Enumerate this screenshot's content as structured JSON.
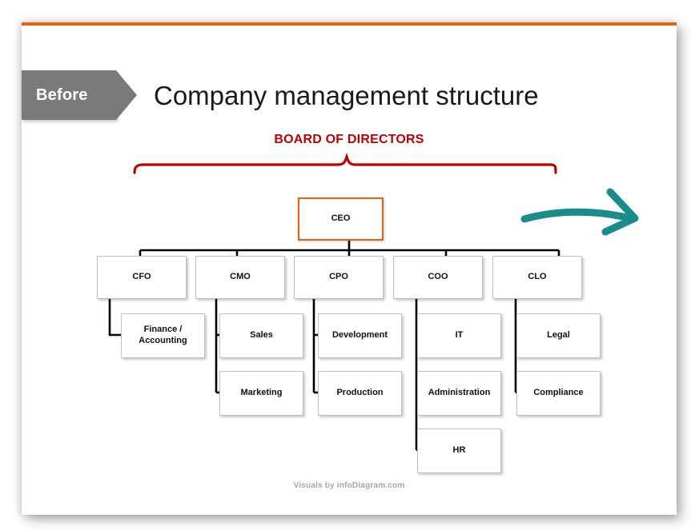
{
  "slide": {
    "before_badge": "Before",
    "title": "Company management structure",
    "footer": "Visuals by infoDiagram.com",
    "accent_top_bar_color": "#E8620C",
    "badge_color": "#7A7A7A"
  },
  "chart": {
    "board_label": "BOARD OF DIRECTORS",
    "board_label_color": "#C00000",
    "brace_color": "#C00000",
    "connector_color": "#000000",
    "box_border_color": "#BFBFBF",
    "ceo_border_color": "#E8620C",
    "arrow_color": "#1B8C8C",
    "ceo": {
      "label": "CEO"
    },
    "executives": [
      {
        "label": "CFO",
        "children": [
          {
            "label": "Finance /\nAccounting"
          }
        ]
      },
      {
        "label": "CMO",
        "children": [
          {
            "label": "Sales"
          },
          {
            "label": "Marketing"
          }
        ]
      },
      {
        "label": "CPO",
        "children": [
          {
            "label": "Development"
          },
          {
            "label": "Production"
          }
        ]
      },
      {
        "label": "COO",
        "children": [
          {
            "label": "IT"
          },
          {
            "label": "Administration"
          },
          {
            "label": "HR"
          }
        ]
      },
      {
        "label": "CLO",
        "children": [
          {
            "label": "Legal"
          },
          {
            "label": "Compliance"
          }
        ]
      }
    ]
  }
}
